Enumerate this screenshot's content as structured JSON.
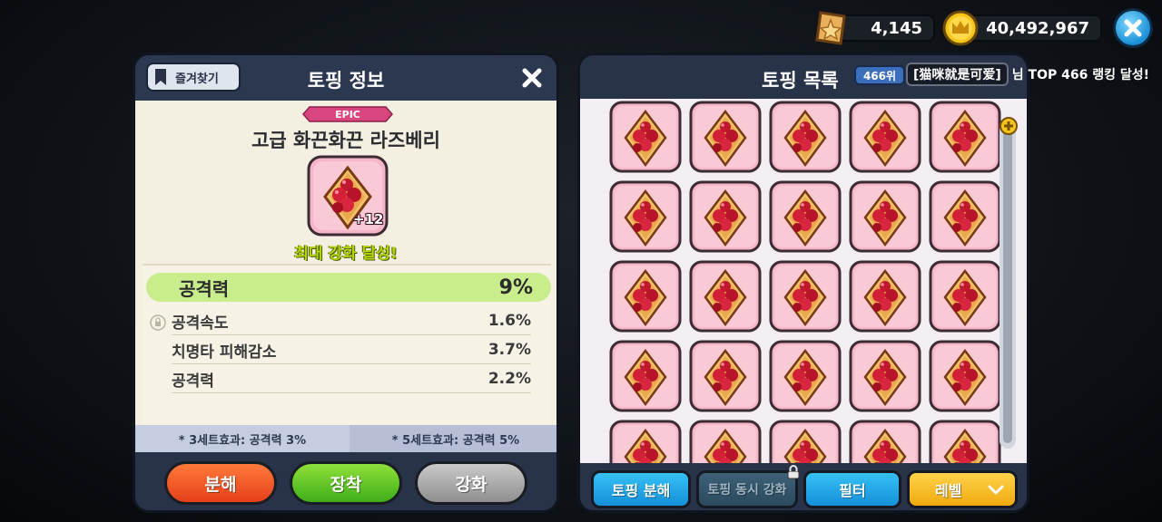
{
  "currency": {
    "shards": "4,145",
    "coins": "40,492,967"
  },
  "info_panel": {
    "favorite_label": "즐겨찾기",
    "title": "토핑 정보",
    "rarity": "EPIC",
    "item_name": "고급 화끈화끈 라즈베리",
    "item_level": "+12",
    "max_text": "최대 강화 달성!",
    "main_stat": {
      "label": "공격력",
      "value": "9%"
    },
    "sub_stats": [
      {
        "label": "공격속도",
        "value": "1.6%"
      },
      {
        "label": "치명타 피해감소",
        "value": "3.7%"
      },
      {
        "label": "공격력",
        "value": "2.2%"
      }
    ],
    "set_effect_3": "* 3세트효과: 공격력 3%",
    "set_effect_5": "* 5세트효과: 공격력 5%",
    "buttons": {
      "dismantle": "분해",
      "equip": "장착",
      "upgrade": "강화"
    }
  },
  "list_panel": {
    "title": "토핑 목록",
    "rank_badge": "466위",
    "ticker_name": "[猫咪就是可爱]",
    "ticker_text": "님 TOP 466 랭킹 달성!",
    "buttons": {
      "dismantle": "토핑 분해",
      "bulk_upgrade": "토핑 동시 강화",
      "filter": "필터",
      "sort": "레벨"
    }
  },
  "colors": {
    "equip_green": "#4fbf1e",
    "dismantle_red": "#ef4a1c",
    "upgrade_gray": "#9a9a9a",
    "blue_button": "#1a9be0",
    "yellow_button": "#f2b91d",
    "epic_pink": "#d8457f"
  }
}
